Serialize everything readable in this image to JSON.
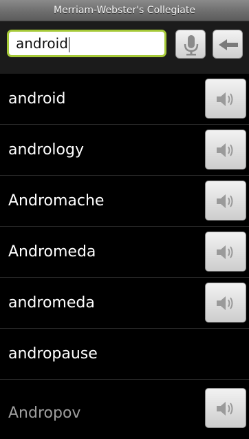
{
  "app": {
    "title": "Merriam-Webster's Collegiate"
  },
  "search": {
    "value": "android"
  },
  "icons": {
    "mic": "microphone-icon",
    "back": "back-arrow-icon",
    "speaker": "speaker-icon"
  },
  "colors": {
    "input_border": "#a6c938",
    "background": "#000000"
  },
  "results": [
    {
      "word": "android",
      "has_audio": true
    },
    {
      "word": "andrology",
      "has_audio": true
    },
    {
      "word": "Andromache",
      "has_audio": true
    },
    {
      "word": "Andromeda",
      "has_audio": true
    },
    {
      "word": "andromeda",
      "has_audio": true
    },
    {
      "word": "andropause",
      "has_audio": false
    },
    {
      "word": "Andropov",
      "has_audio": true
    }
  ]
}
